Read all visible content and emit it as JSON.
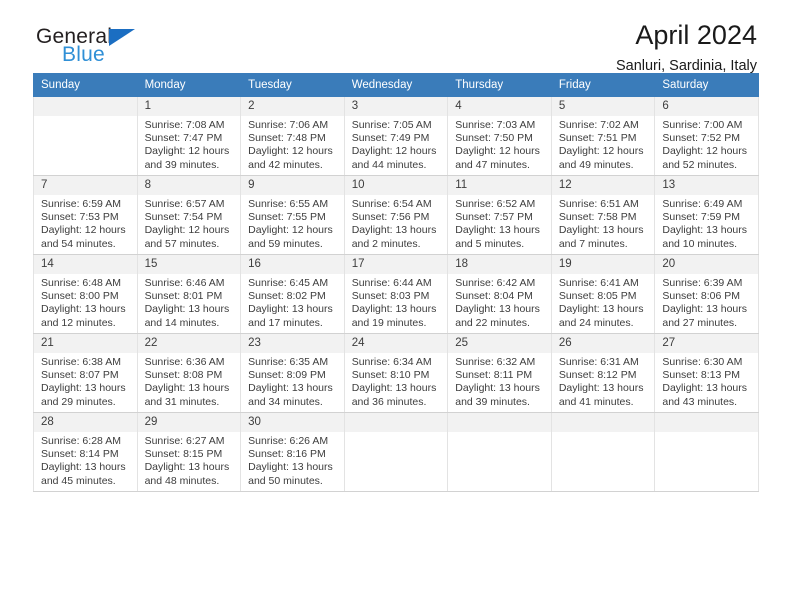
{
  "brand": {
    "line1": "General",
    "line2": "Blue",
    "flag_color": "#1b6ec2",
    "line2_color": "#2f8fd6"
  },
  "header": {
    "title": "April 2024",
    "subtitle": "Sanluri, Sardinia, Italy"
  },
  "calendar": {
    "header_bg": "#3a7cba",
    "daynum_bg": "#f2f2f2",
    "weekdays": [
      "Sunday",
      "Monday",
      "Tuesday",
      "Wednesday",
      "Thursday",
      "Friday",
      "Saturday"
    ],
    "weeks": [
      [
        {
          "empty": true,
          "day": ""
        },
        {
          "day": "1",
          "sunrise": "Sunrise: 7:08 AM",
          "sunset": "Sunset: 7:47 PM",
          "daylight": "Daylight: 12 hours and 39 minutes."
        },
        {
          "day": "2",
          "sunrise": "Sunrise: 7:06 AM",
          "sunset": "Sunset: 7:48 PM",
          "daylight": "Daylight: 12 hours and 42 minutes."
        },
        {
          "day": "3",
          "sunrise": "Sunrise: 7:05 AM",
          "sunset": "Sunset: 7:49 PM",
          "daylight": "Daylight: 12 hours and 44 minutes."
        },
        {
          "day": "4",
          "sunrise": "Sunrise: 7:03 AM",
          "sunset": "Sunset: 7:50 PM",
          "daylight": "Daylight: 12 hours and 47 minutes."
        },
        {
          "day": "5",
          "sunrise": "Sunrise: 7:02 AM",
          "sunset": "Sunset: 7:51 PM",
          "daylight": "Daylight: 12 hours and 49 minutes."
        },
        {
          "day": "6",
          "sunrise": "Sunrise: 7:00 AM",
          "sunset": "Sunset: 7:52 PM",
          "daylight": "Daylight: 12 hours and 52 minutes."
        }
      ],
      [
        {
          "day": "7",
          "sunrise": "Sunrise: 6:59 AM",
          "sunset": "Sunset: 7:53 PM",
          "daylight": "Daylight: 12 hours and 54 minutes."
        },
        {
          "day": "8",
          "sunrise": "Sunrise: 6:57 AM",
          "sunset": "Sunset: 7:54 PM",
          "daylight": "Daylight: 12 hours and 57 minutes."
        },
        {
          "day": "9",
          "sunrise": "Sunrise: 6:55 AM",
          "sunset": "Sunset: 7:55 PM",
          "daylight": "Daylight: 12 hours and 59 minutes."
        },
        {
          "day": "10",
          "sunrise": "Sunrise: 6:54 AM",
          "sunset": "Sunset: 7:56 PM",
          "daylight": "Daylight: 13 hours and 2 minutes."
        },
        {
          "day": "11",
          "sunrise": "Sunrise: 6:52 AM",
          "sunset": "Sunset: 7:57 PM",
          "daylight": "Daylight: 13 hours and 5 minutes."
        },
        {
          "day": "12",
          "sunrise": "Sunrise: 6:51 AM",
          "sunset": "Sunset: 7:58 PM",
          "daylight": "Daylight: 13 hours and 7 minutes."
        },
        {
          "day": "13",
          "sunrise": "Sunrise: 6:49 AM",
          "sunset": "Sunset: 7:59 PM",
          "daylight": "Daylight: 13 hours and 10 minutes."
        }
      ],
      [
        {
          "day": "14",
          "sunrise": "Sunrise: 6:48 AM",
          "sunset": "Sunset: 8:00 PM",
          "daylight": "Daylight: 13 hours and 12 minutes."
        },
        {
          "day": "15",
          "sunrise": "Sunrise: 6:46 AM",
          "sunset": "Sunset: 8:01 PM",
          "daylight": "Daylight: 13 hours and 14 minutes."
        },
        {
          "day": "16",
          "sunrise": "Sunrise: 6:45 AM",
          "sunset": "Sunset: 8:02 PM",
          "daylight": "Daylight: 13 hours and 17 minutes."
        },
        {
          "day": "17",
          "sunrise": "Sunrise: 6:44 AM",
          "sunset": "Sunset: 8:03 PM",
          "daylight": "Daylight: 13 hours and 19 minutes."
        },
        {
          "day": "18",
          "sunrise": "Sunrise: 6:42 AM",
          "sunset": "Sunset: 8:04 PM",
          "daylight": "Daylight: 13 hours and 22 minutes."
        },
        {
          "day": "19",
          "sunrise": "Sunrise: 6:41 AM",
          "sunset": "Sunset: 8:05 PM",
          "daylight": "Daylight: 13 hours and 24 minutes."
        },
        {
          "day": "20",
          "sunrise": "Sunrise: 6:39 AM",
          "sunset": "Sunset: 8:06 PM",
          "daylight": "Daylight: 13 hours and 27 minutes."
        }
      ],
      [
        {
          "day": "21",
          "sunrise": "Sunrise: 6:38 AM",
          "sunset": "Sunset: 8:07 PM",
          "daylight": "Daylight: 13 hours and 29 minutes."
        },
        {
          "day": "22",
          "sunrise": "Sunrise: 6:36 AM",
          "sunset": "Sunset: 8:08 PM",
          "daylight": "Daylight: 13 hours and 31 minutes."
        },
        {
          "day": "23",
          "sunrise": "Sunrise: 6:35 AM",
          "sunset": "Sunset: 8:09 PM",
          "daylight": "Daylight: 13 hours and 34 minutes."
        },
        {
          "day": "24",
          "sunrise": "Sunrise: 6:34 AM",
          "sunset": "Sunset: 8:10 PM",
          "daylight": "Daylight: 13 hours and 36 minutes."
        },
        {
          "day": "25",
          "sunrise": "Sunrise: 6:32 AM",
          "sunset": "Sunset: 8:11 PM",
          "daylight": "Daylight: 13 hours and 39 minutes."
        },
        {
          "day": "26",
          "sunrise": "Sunrise: 6:31 AM",
          "sunset": "Sunset: 8:12 PM",
          "daylight": "Daylight: 13 hours and 41 minutes."
        },
        {
          "day": "27",
          "sunrise": "Sunrise: 6:30 AM",
          "sunset": "Sunset: 8:13 PM",
          "daylight": "Daylight: 13 hours and 43 minutes."
        }
      ],
      [
        {
          "day": "28",
          "sunrise": "Sunrise: 6:28 AM",
          "sunset": "Sunset: 8:14 PM",
          "daylight": "Daylight: 13 hours and 45 minutes."
        },
        {
          "day": "29",
          "sunrise": "Sunrise: 6:27 AM",
          "sunset": "Sunset: 8:15 PM",
          "daylight": "Daylight: 13 hours and 48 minutes."
        },
        {
          "day": "30",
          "sunrise": "Sunrise: 6:26 AM",
          "sunset": "Sunset: 8:16 PM",
          "daylight": "Daylight: 13 hours and 50 minutes."
        },
        {
          "empty": true,
          "day": ""
        },
        {
          "empty": true,
          "day": ""
        },
        {
          "empty": true,
          "day": ""
        },
        {
          "empty": true,
          "day": ""
        }
      ]
    ]
  }
}
